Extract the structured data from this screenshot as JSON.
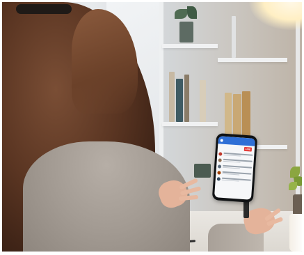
{
  "scene": {
    "description_colors": {
      "hair": "#5a3522",
      "sweater": "#a29a92",
      "skin": "#e4b39a",
      "phone_header": "#2f6fd6",
      "live_badge": "#e53935"
    }
  },
  "phone": {
    "screen_title": "",
    "live_label": "LIVE",
    "messages": [
      {
        "avatar_color": "#c0392b"
      },
      {
        "avatar_color": "#8e6e53"
      },
      {
        "avatar_color": "#5d6d7e"
      },
      {
        "avatar_color": "#a04000"
      },
      {
        "avatar_color": "#34495e"
      }
    ]
  }
}
